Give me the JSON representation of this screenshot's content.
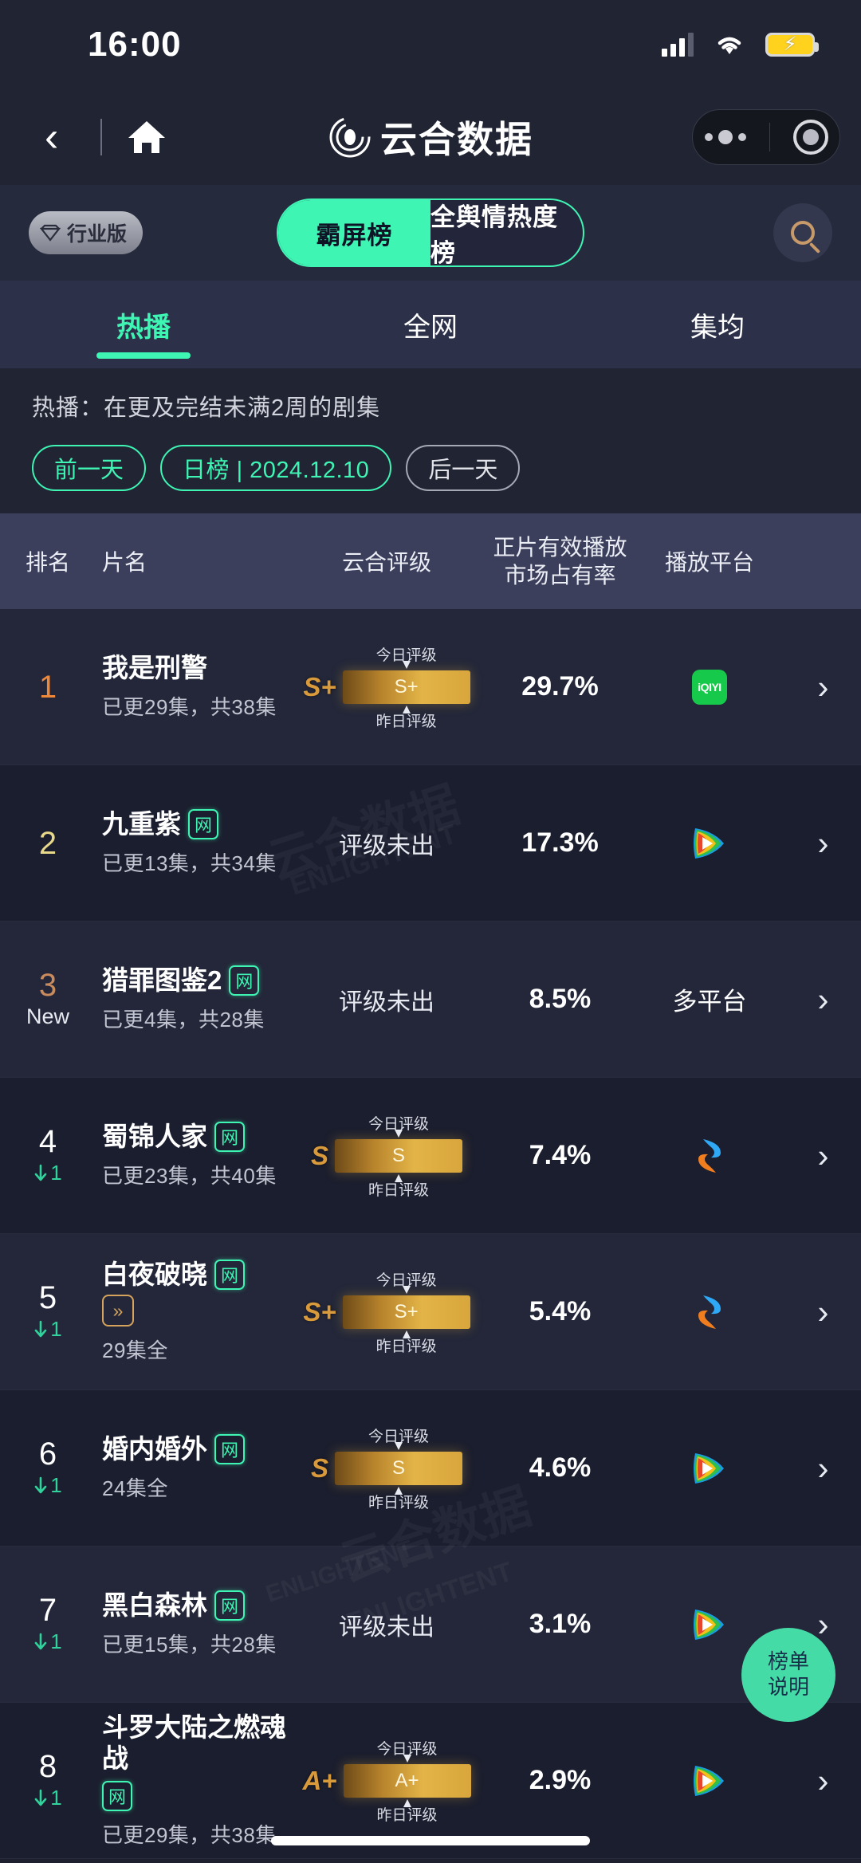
{
  "status_bar": {
    "time": "16:00",
    "signal_icon": "signal-bars-icon",
    "wifi_icon": "wifi-icon",
    "battery_icon": "battery-charging-icon"
  },
  "nav": {
    "back_icon": "chevron-left-icon",
    "home_icon": "home-icon",
    "title": "云合数据",
    "logo_icon": "yunhe-logo-icon",
    "menu_icon": "ellipsis-icon",
    "close_icon": "target-circle-icon"
  },
  "header": {
    "pro_badge": "行业版",
    "pro_badge_icon": "diamond-icon",
    "search_icon": "search-icon",
    "segments": [
      {
        "label": "霸屏榜",
        "active": true
      },
      {
        "label": "全舆情热度榜",
        "active": false
      }
    ]
  },
  "tabs": [
    {
      "label": "热播",
      "active": true
    },
    {
      "label": "全网",
      "active": false
    },
    {
      "label": "集均",
      "active": false
    }
  ],
  "info": {
    "description": "热播：在更及完结未满2周的剧集",
    "prev_day": "前一天",
    "date_label": "日榜 | 2024.12.10",
    "next_day": "后一天"
  },
  "table": {
    "headers": {
      "rank": "排名",
      "title": "片名",
      "rating": "云合评级",
      "share_line1": "正片有效播放",
      "share_line2": "市场占有率",
      "platform": "播放平台"
    },
    "rating_labels": {
      "today": "今日评级",
      "yesterday": "昨日评级"
    },
    "no_rating_text": "评级未出",
    "multi_platform_text": "多平台",
    "row_arrow_icon": "chevron-right-icon"
  },
  "rows": [
    {
      "rank": "1",
      "rank_color": "#f0883a",
      "delta": "",
      "delta_type": "none",
      "title": "我是刑警",
      "net_tag": false,
      "vip_tag": false,
      "episodes": "已更29集，共38集",
      "rating": "S+",
      "has_rating": true,
      "share": "29.7%",
      "platform_icon": "iqiyi-icon",
      "platform_text": "",
      "platform_label": "iQIYI"
    },
    {
      "rank": "2",
      "rank_color": "#e8d98a",
      "delta": "",
      "delta_type": "none",
      "title": "九重紫",
      "net_tag": true,
      "vip_tag": false,
      "episodes": "已更13集，共34集",
      "rating": "",
      "has_rating": false,
      "share": "17.3%",
      "platform_icon": "youku-icon",
      "platform_text": "",
      "platform_label": "优酷"
    },
    {
      "rank": "3",
      "rank_color": "#c98b5e",
      "delta": "New",
      "delta_type": "new",
      "title": "猎罪图鉴2",
      "net_tag": true,
      "vip_tag": false,
      "episodes": "已更4集，共28集",
      "rating": "",
      "has_rating": false,
      "share": "8.5%",
      "platform_icon": "",
      "platform_text": "多平台",
      "platform_label": "多平台"
    },
    {
      "rank": "4",
      "rank_color": "#ffffff",
      "delta": "1",
      "delta_type": "down",
      "title": "蜀锦人家",
      "net_tag": true,
      "vip_tag": false,
      "episodes": "已更23集，共40集",
      "rating": "S",
      "has_rating": true,
      "share": "7.4%",
      "platform_icon": "tencent-video-icon",
      "platform_text": "",
      "platform_label": "腾讯视频"
    },
    {
      "rank": "5",
      "rank_color": "#ffffff",
      "delta": "1",
      "delta_type": "down",
      "title": "白夜破晓",
      "net_tag": true,
      "vip_tag": true,
      "episodes": "29集全",
      "rating": "S+",
      "has_rating": true,
      "share": "5.4%",
      "platform_icon": "tencent-video-icon",
      "platform_text": "",
      "platform_label": "腾讯视频"
    },
    {
      "rank": "6",
      "rank_color": "#ffffff",
      "delta": "1",
      "delta_type": "down",
      "title": "婚内婚外",
      "net_tag": true,
      "vip_tag": false,
      "episodes": "24集全",
      "rating": "S",
      "has_rating": true,
      "share": "4.6%",
      "platform_icon": "youku-icon",
      "platform_text": "",
      "platform_label": "优酷"
    },
    {
      "rank": "7",
      "rank_color": "#ffffff",
      "delta": "1",
      "delta_type": "down",
      "title": "黑白森林",
      "net_tag": true,
      "vip_tag": false,
      "episodes": "已更15集，共28集",
      "rating": "",
      "has_rating": false,
      "share": "3.1%",
      "platform_icon": "youku-icon",
      "platform_text": "",
      "platform_label": "优酷"
    },
    {
      "rank": "8",
      "rank_color": "#ffffff",
      "delta": "1",
      "delta_type": "down",
      "title": "斗罗大陆之燃魂战",
      "net_tag": true,
      "vip_tag": false,
      "episodes": "已更29集，共38集",
      "rating": "A+",
      "has_rating": true,
      "share": "2.9%",
      "platform_icon": "youku-icon",
      "platform_text": "",
      "platform_label": "优酷"
    }
  ],
  "fab": {
    "line1": "榜单",
    "line2": "说明"
  },
  "watermark": {
    "text": "云合数据",
    "sub": "ENLIGHTENT"
  },
  "colors": {
    "accent_green": "#3ef5b4",
    "page_bg": "#1e2030",
    "header_bg": "#262a3d",
    "tab_bg": "#2c3049",
    "table_header_bg": "#3b3f5c",
    "row_odd": "#232739",
    "row_even": "#1b1e2e",
    "gold": "#d8a63c",
    "fab_bg": "#45dba6"
  }
}
